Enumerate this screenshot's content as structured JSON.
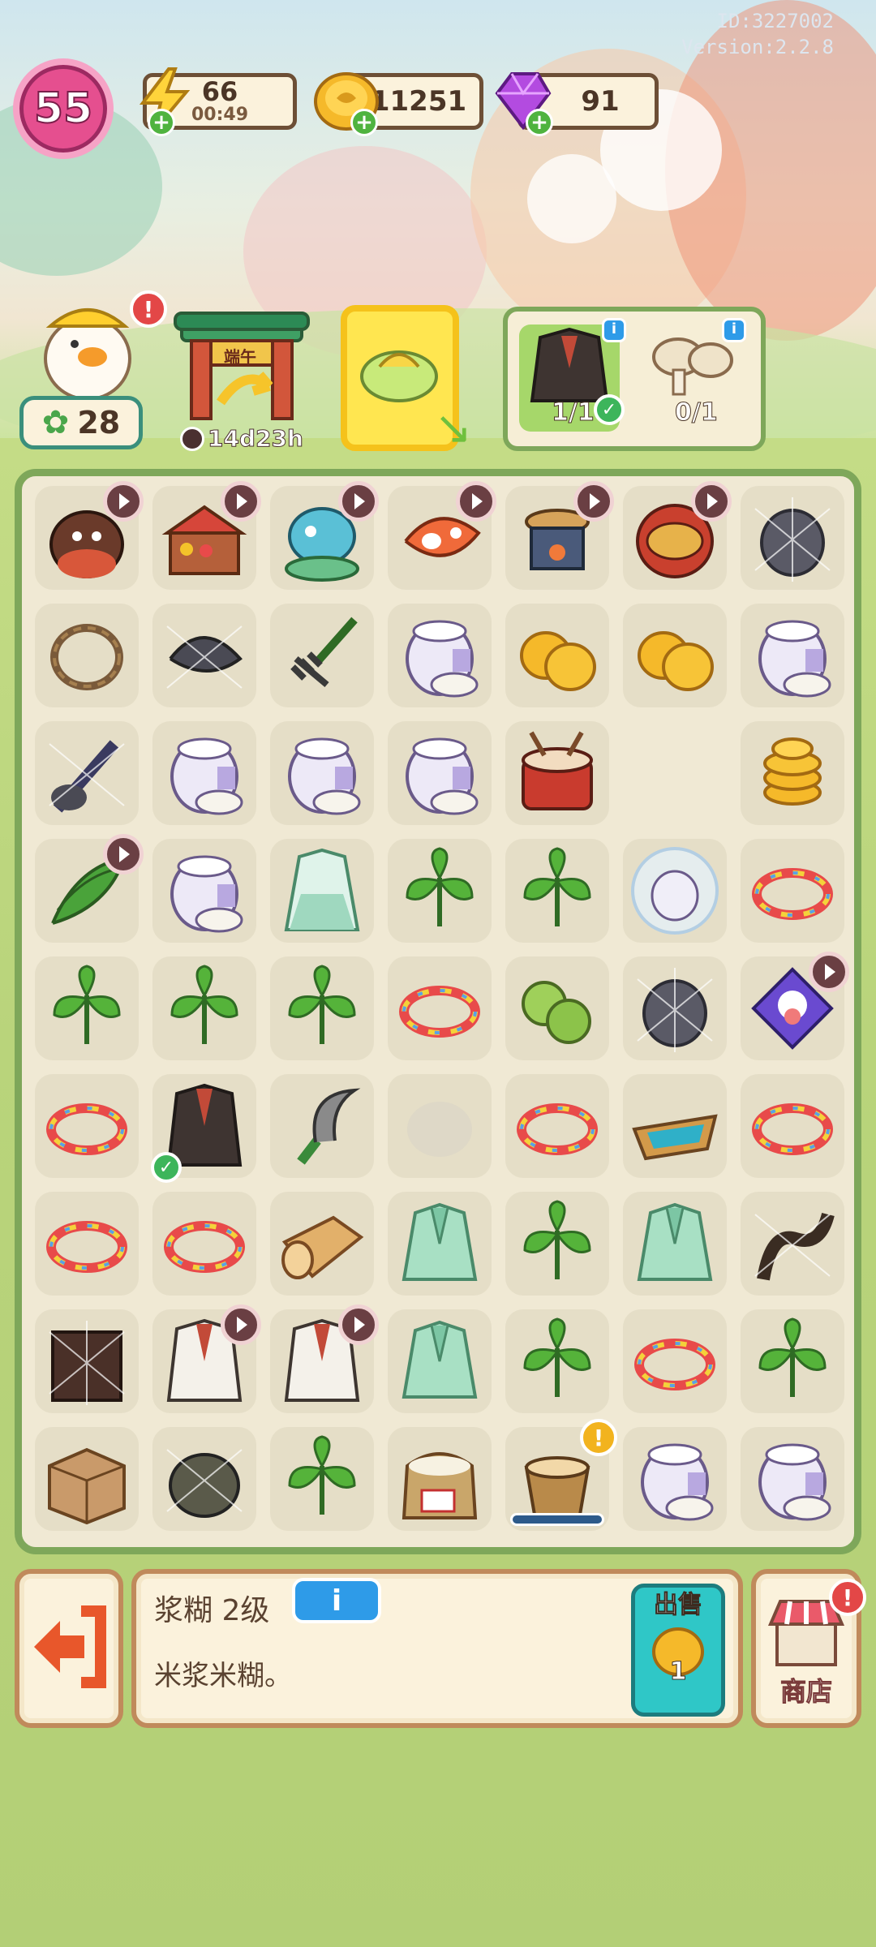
{
  "header": {
    "id_text": "ID:3227002",
    "version_text": "Version:2.2.8",
    "level": "55",
    "energy": {
      "value": "66",
      "timer": "00:49",
      "icon": "lightning-icon"
    },
    "coins": {
      "value": "11251",
      "icon": "coin-icon"
    },
    "gems": {
      "value": "91",
      "icon": "gem-icon"
    }
  },
  "quests": {
    "duck_helper": {
      "count": "28"
    },
    "festival_gate": {
      "sign": "端午",
      "timer": "14d23h"
    },
    "orders": [
      {
        "item": "hanfu-robe",
        "progress": "1/1"
      },
      {
        "item": "mushrooms",
        "progress": "0/1"
      }
    ]
  },
  "board": {
    "rows": [
      [
        "zongzi-bear",
        "market-stall",
        "dragon-boat-head",
        "koi-fish",
        "steamer-stove",
        "festival-drum",
        "cobweb-pot"
      ],
      [
        "wreath",
        "cobweb-stone",
        "rake",
        "paste-jar",
        "coins",
        "coins",
        "paste-jar"
      ],
      [
        "cobweb-brush",
        "paste-jar",
        "paste-jar",
        "paste-jar",
        "drum",
        "empty",
        "coin-stack"
      ],
      [
        "bamboo-leaves",
        "paste-jar",
        "green-hanfu",
        "mugwort",
        "mugwort",
        "bubble-jar",
        "color-cord"
      ],
      [
        "mugwort",
        "mugwort",
        "mugwort",
        "color-cord",
        "green-plums",
        "cobweb-pot",
        "kite"
      ],
      [
        "color-cord",
        "hanfu-robe",
        "sickle",
        "ghost",
        "color-cord",
        "wooden-boat",
        "color-cord"
      ],
      [
        "color-cord",
        "color-cord",
        "wood-log",
        "green-robe",
        "mugwort",
        "green-robe",
        "cobweb-root"
      ],
      [
        "cobweb-box",
        "white-robe",
        "white-robe",
        "green-robe",
        "mugwort",
        "color-cord",
        "mugwort"
      ],
      [
        "cardboard-box",
        "cobweb-sack",
        "mugwort",
        "rice-sack",
        "bucket",
        "paste-jar",
        "paste-jar"
      ]
    ]
  },
  "detail": {
    "title": "浆糊 2级",
    "description": "米浆米糊。",
    "sell_label": "出售",
    "sell_price": "1",
    "shop_label": "商店"
  },
  "colors": {
    "accent": "#e54f8f",
    "board_border": "#7ea75a",
    "info": "#2e9be8"
  }
}
